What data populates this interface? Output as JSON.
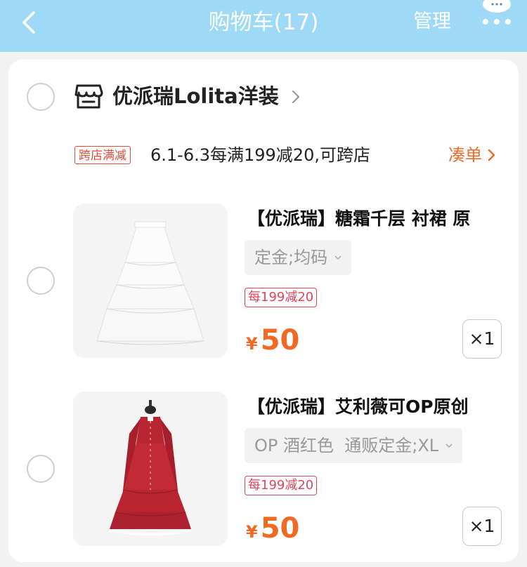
{
  "header": {
    "title": "购物车(17)",
    "manage_label": "管理",
    "back_icon": "chevron-left-icon",
    "more_icon": "more-dots-icon",
    "background_color": "#9ed9f5"
  },
  "store": {
    "name": "优派瑞Lolita洋装",
    "icon": "store-icon",
    "promo_tag": "跨店满减",
    "promo_text": "6.1-6.3每满199减20,可跨店",
    "add_on_label": "凑单"
  },
  "items": [
    {
      "title": "【优派瑞】糖霜千层 衬裙 原",
      "sku": "定金;均码",
      "discount": "每199减20",
      "currency": "¥",
      "price": "50",
      "quantity": "×1",
      "image": "white-tiered-petticoat"
    },
    {
      "title": "【优派瑞】艾利薇可OP原创",
      "sku": "OP 酒红色  通贩定金;XL",
      "discount": "每199减20",
      "currency": "¥",
      "price": "50",
      "quantity": "×1",
      "image": "wine-red-dress"
    }
  ],
  "colors": {
    "accent_orange": "#f06a23",
    "promo_red": "#e04b3a"
  }
}
